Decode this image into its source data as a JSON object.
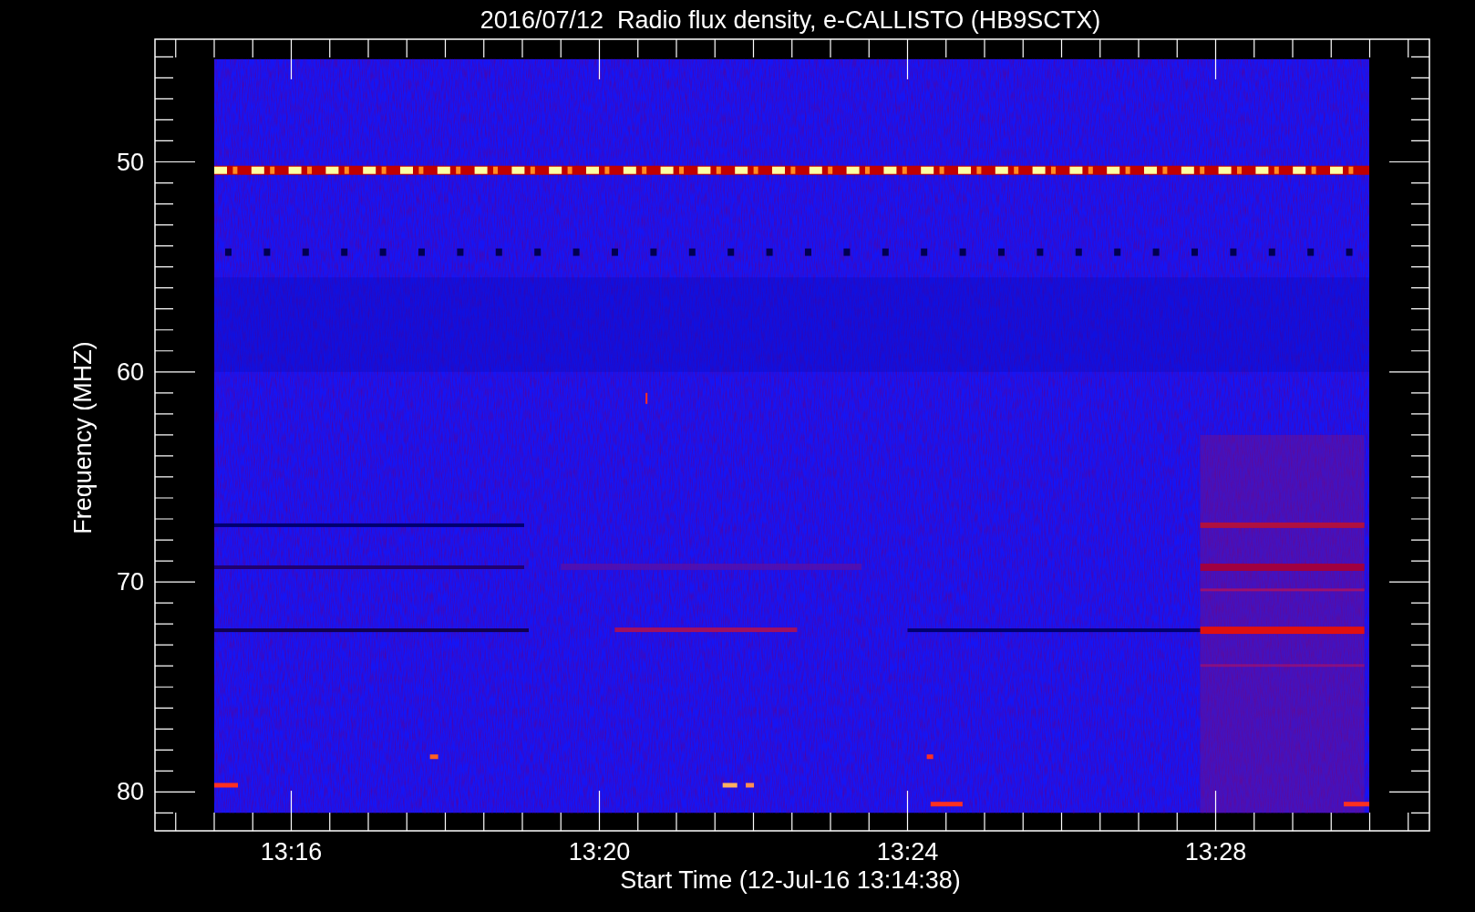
{
  "title": "2016/07/12  Radio flux density, e-CALLISTO (HB9SCTX)",
  "xlabel": "Start Time (12-Jul-16 13:14:38)",
  "ylabel": "Frequency (MHZ)",
  "xticks": [
    "13:16",
    "13:20",
    "13:24",
    "13:28"
  ],
  "yticks": [
    "50",
    "60",
    "70",
    "80"
  ]
}
